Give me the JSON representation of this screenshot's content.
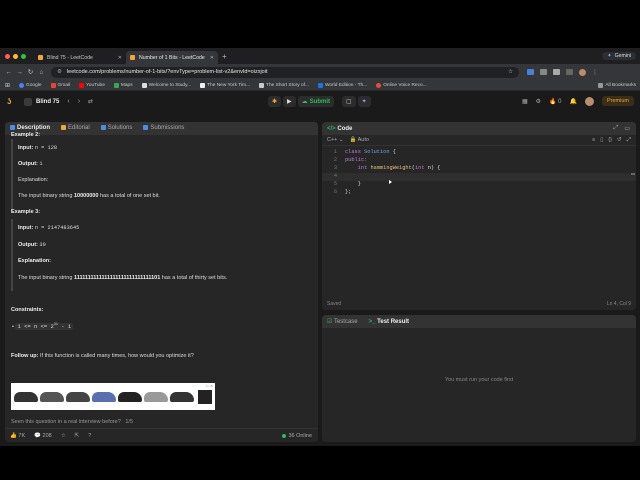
{
  "browser": {
    "tabs": [
      {
        "title": "Blind 75 - LeetCode",
        "active": false
      },
      {
        "title": "Number of 1 Bits - LeetCode",
        "active": true
      }
    ],
    "gemini_label": "Gemini",
    "url": "leetcode.com/problems/number-of-1-bits/?envType=problem-list-v2&envId=oizxjoit",
    "bookmarks": [
      "Google",
      "Gmail",
      "YouTube",
      "Maps",
      "Welcome to Study...",
      "The New York Tim...",
      "The Short Story of...",
      "World Edition - Th...",
      "Online Voice Reco..."
    ],
    "all_bookmarks": "All Bookmarks"
  },
  "lc": {
    "problem_list": "Blind 75",
    "submit_label": "Submit",
    "streak": "0",
    "premium": "Premium"
  },
  "left": {
    "tabs": {
      "description": "Description",
      "editorial": "Editorial",
      "solutions": "Solutions",
      "submissions": "Submissions"
    },
    "ex2": {
      "title": "Example 2:",
      "input_label": "Input:",
      "input_val": "n = 128",
      "output_label": "Output:",
      "output_val": "1",
      "expl_label": "Explanation:",
      "expl_pre": "The input binary string ",
      "expl_bits": "10000000",
      "expl_post": " has a total of one set bit."
    },
    "ex3": {
      "title": "Example 3:",
      "input_label": "Input:",
      "input_val": "n = 2147483645",
      "output_label": "Output:",
      "output_val": "30",
      "expl_label": "Explanation:",
      "expl_pre": "The input binary string ",
      "expl_bits": "1111111111111111111111111111101",
      "expl_post": " has a total of thirty set bits."
    },
    "constraints_title": "Constraints:",
    "constraint_base": "1 <= n <= 2",
    "constraint_exp": "31",
    "constraint_tail": " - 1",
    "followup_label": "Follow up:",
    "followup_text": " If this function is called many times, how would you optimize it?",
    "ad_label": "▷ ✕",
    "fold_text": "Seen this question in a real interview before?",
    "fold_count": "1/5",
    "footer": {
      "likes": "7K",
      "comments": "208",
      "online": "36 Online"
    }
  },
  "code": {
    "title": "Code",
    "lang": "C++",
    "auto": "Auto",
    "lines": [
      {
        "n": "1",
        "t": "class Solution {"
      },
      {
        "n": "2",
        "t": "public:"
      },
      {
        "n": "3",
        "t": "    int hammingWeight(int n) {"
      },
      {
        "n": "4",
        "t": "        "
      },
      {
        "n": "5",
        "t": "    }"
      },
      {
        "n": "6",
        "t": "};"
      }
    ],
    "saved": "Saved",
    "position": "Ln 4, Col 9"
  },
  "test": {
    "testcase_tab": "Testcase",
    "result_tab": "Test Result",
    "empty_msg": "You must run your code first"
  },
  "colors": {
    "accent": "#f0a63a",
    "submit": "#2cbb5d",
    "panel": "#262626"
  }
}
